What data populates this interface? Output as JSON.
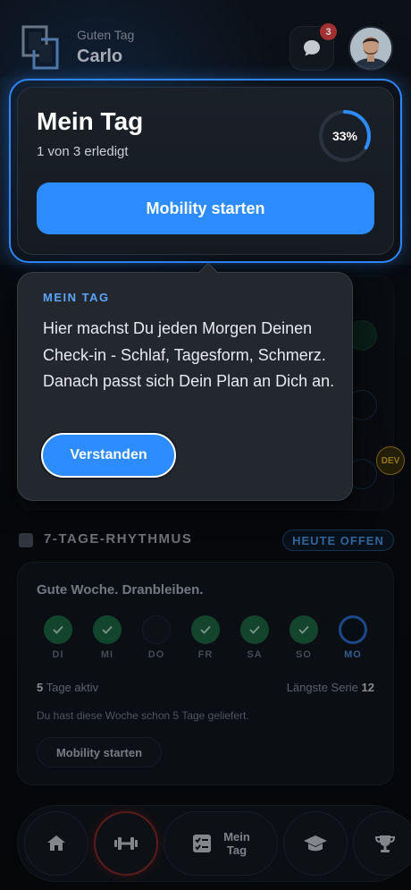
{
  "header": {
    "greeting": "Guten Tag",
    "user_name": "Carlo",
    "chat_icon": "chat-bubble-icon",
    "chat_badge_count": "3"
  },
  "mein_tag_card": {
    "title": "Mein Tag",
    "subtitle": "1 von 3 erledigt",
    "progress_label": "33%",
    "progress_fraction": 0.33,
    "cta_label": "Mobility starten"
  },
  "tooltip": {
    "kicker": "MEIN TAG",
    "body": "Hier machst Du jeden Morgen Deinen Check-in - Schlaf, Tagesform, Schmerz. Danach passt sich Dein Plan an Dich an.",
    "confirm_label": "Verstanden"
  },
  "dev_badge": "DEV",
  "rhythm": {
    "section_title": "7-TAGE-RHYTHMUS",
    "status_pill": "HEUTE OFFEN",
    "card_title": "Gute Woche. Dranbleiben.",
    "days": [
      {
        "label": "DI",
        "state": "done"
      },
      {
        "label": "MI",
        "state": "done"
      },
      {
        "label": "DO",
        "state": "open"
      },
      {
        "label": "FR",
        "state": "done"
      },
      {
        "label": "SA",
        "state": "done"
      },
      {
        "label": "SO",
        "state": "done"
      },
      {
        "label": "MO",
        "state": "today"
      }
    ],
    "active_count": "5",
    "active_suffix": " Tage aktiv",
    "streak_label": "Längste Serie ",
    "streak_value": "12",
    "note": "Du hast diese Woche schon 5 Tage geliefert.",
    "button_label": "Mobility starten"
  },
  "bottom_nav": {
    "items": [
      {
        "icon": "home-icon"
      },
      {
        "icon": "dumbbell-icon",
        "active": true
      },
      {
        "icon": "checklist-icon",
        "label_line1": "Mein",
        "label_line2": "Tag"
      },
      {
        "icon": "graduation-cap-icon"
      },
      {
        "icon": "trophy-icon"
      }
    ]
  },
  "colors": {
    "accent": "#2d8cff",
    "done_green": "#1e6b46",
    "badge_red": "#c0393b",
    "dev_gold": "#e0b530"
  }
}
